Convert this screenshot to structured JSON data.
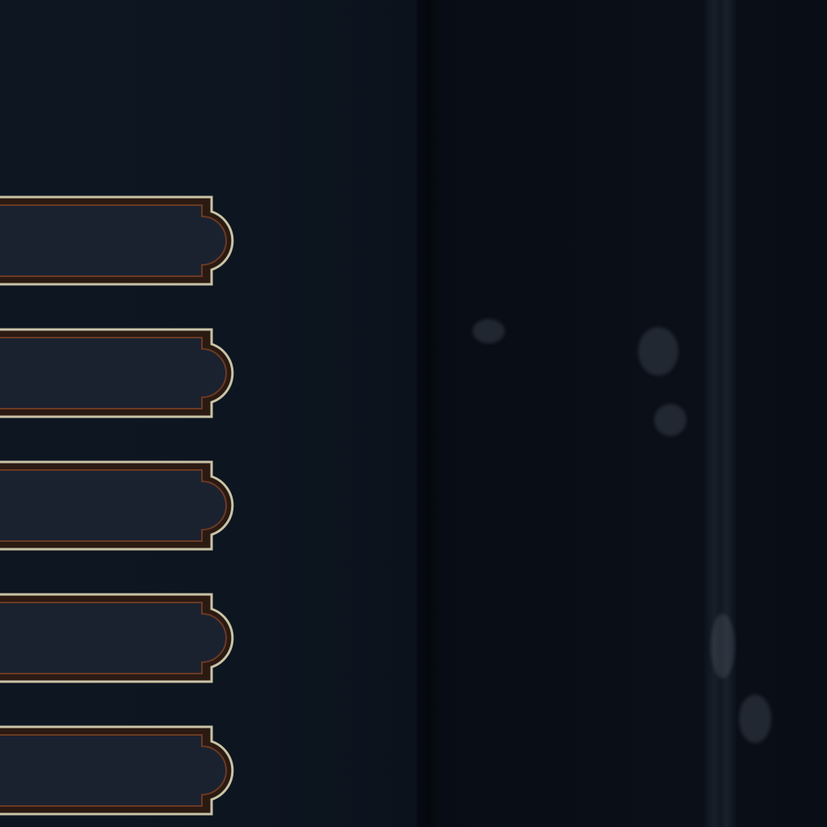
{
  "menu": {
    "slots": [
      {
        "label": ""
      },
      {
        "label": ""
      },
      {
        "label": ""
      },
      {
        "label": ""
      },
      {
        "label": ""
      }
    ]
  },
  "colors": {
    "background": "#0b111b",
    "slot_fill": "#1a2230",
    "frame_gold": "#c9c3a6",
    "frame_dark": "#2a1a12"
  }
}
